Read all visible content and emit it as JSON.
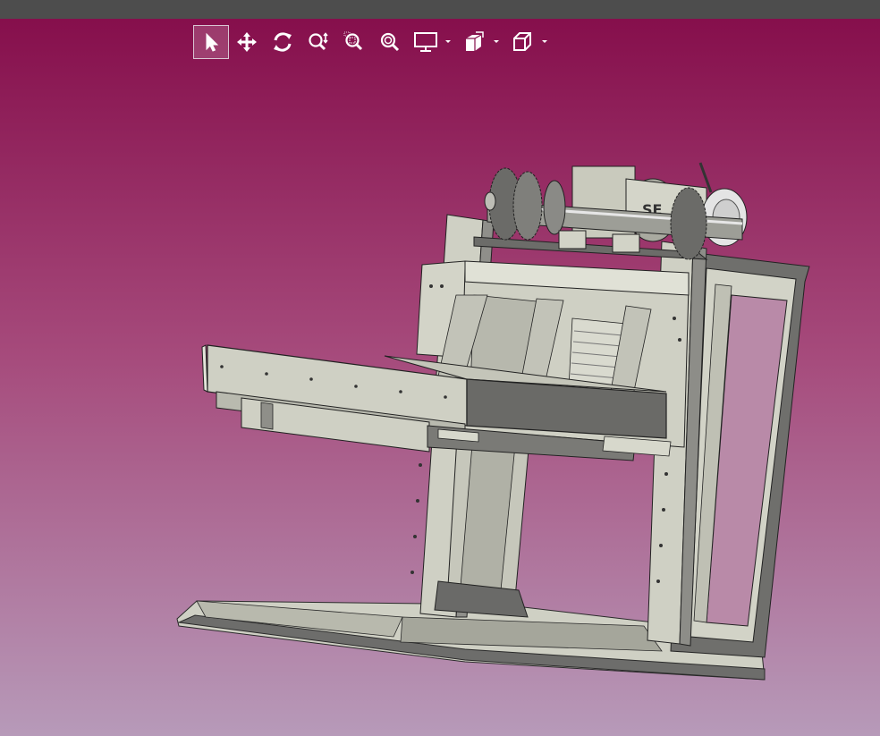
{
  "app": {
    "title_bar": ""
  },
  "toolbar": {
    "tools": [
      {
        "id": "select",
        "icon": "cursor-arrow-icon",
        "active": true
      },
      {
        "id": "pan",
        "icon": "pan-arrows-icon",
        "active": false
      },
      {
        "id": "rotate",
        "icon": "rotate-icon",
        "active": false
      },
      {
        "id": "zoom",
        "icon": "zoom-icon",
        "active": false
      },
      {
        "id": "zoom-window",
        "icon": "zoom-window-icon",
        "active": false
      },
      {
        "id": "zoom-fit",
        "icon": "zoom-fit-icon",
        "active": false
      },
      {
        "id": "display-mode",
        "icon": "monitor-icon",
        "has_dropdown": true
      },
      {
        "id": "section-view",
        "icon": "section-cube-icon",
        "has_dropdown": true
      },
      {
        "id": "view-orientation",
        "icon": "view-cube-icon",
        "has_dropdown": true
      }
    ],
    "icon_color": "#ffffff"
  },
  "viewport": {
    "background_top": "#860f4c",
    "background_bottom": "#b79ab9",
    "model_color": "#c9cbbd",
    "model_dark": "#6d6d6b",
    "motor_label": "SE"
  }
}
